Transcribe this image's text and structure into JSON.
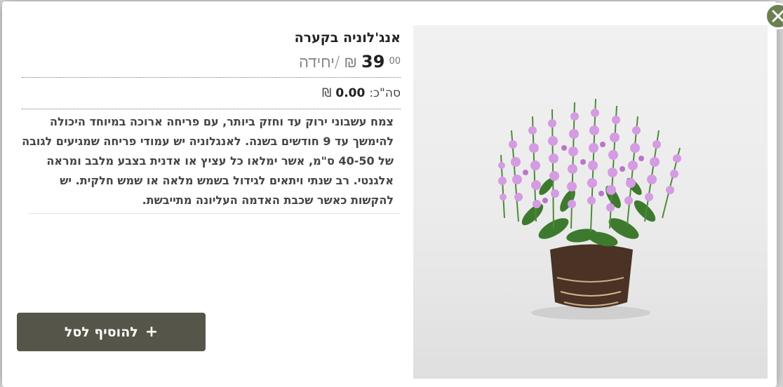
{
  "product": {
    "title": "אנג'לוניה בקערה",
    "price_int": "39",
    "price_dec": "00",
    "currency": "₪",
    "unit": "/יחידה",
    "total_label": "סה\"כ:",
    "total_value": "0.00",
    "total_currency": "₪",
    "description": "צמח עשבוני ירוק עד וחזק ביותר, עם פריחה ארוכה במיוחד היכולה להימשך עד 9 חודשים בשנה. לאנגלוניה יש עמודי פריחה שמגיעים לגובה של 40-50 ס\"מ, אשר ימלאו כל עציץ או אדנית בצבע מלבב ומראה אלגנטי. רב שנתי ויתאים לגידול בשמש מלאה או שמש חלקית. יש להקשות כאשר שכבת האדמה העליונה מתייבשת."
  },
  "actions": {
    "add_to_cart": "להוסיף לסל",
    "add_icon": "plus-icon",
    "close_icon": "close-icon"
  },
  "colors": {
    "button_bg": "#565549",
    "close_bg": "#6b7f50",
    "flower": "#d59be3"
  }
}
